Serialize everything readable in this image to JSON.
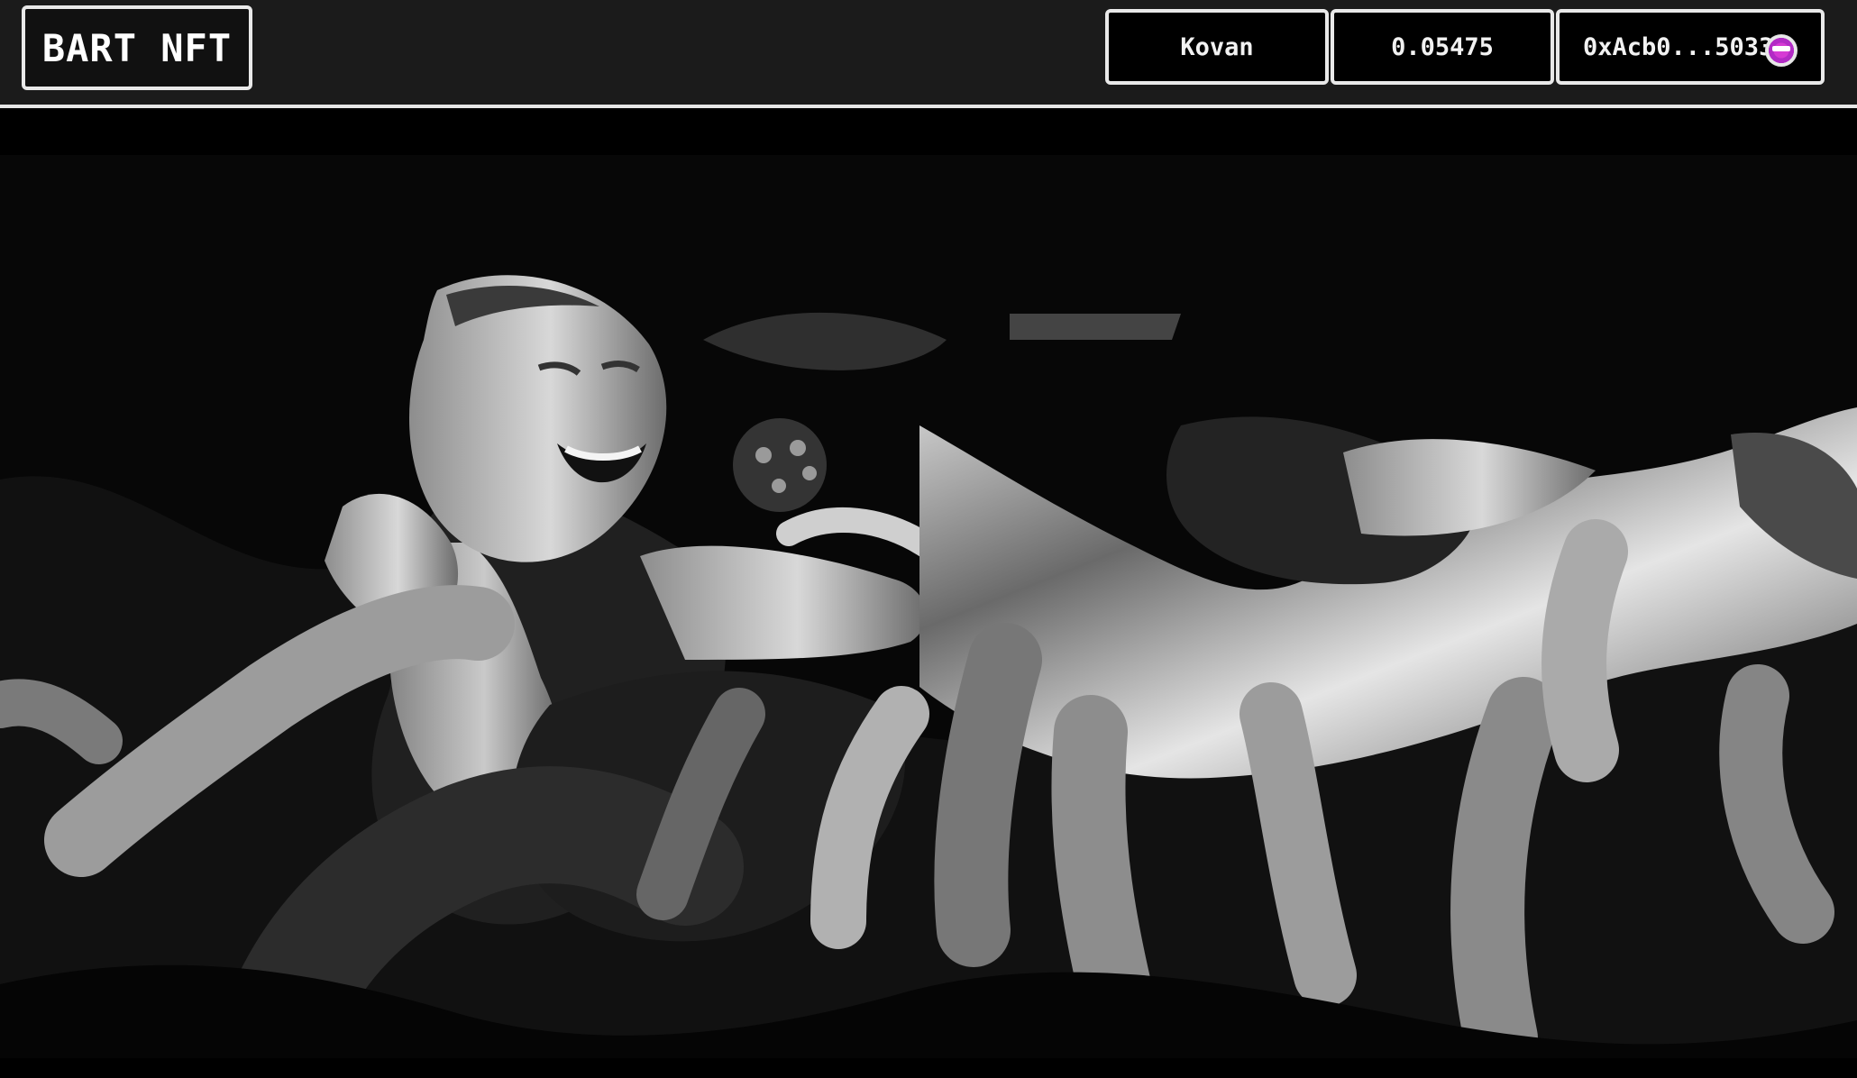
{
  "header": {
    "brand": "BART NFT",
    "network": "Kovan",
    "balance": "0.05475",
    "account": "0xAcb0...5033"
  },
  "icons": {
    "avatar": "wallet-avatar-icon"
  },
  "colors": {
    "header_background": "#1b1b1b",
    "page_background": "#000000",
    "border": "#e9e9e9",
    "avatar_accent": "#d63ad4"
  }
}
